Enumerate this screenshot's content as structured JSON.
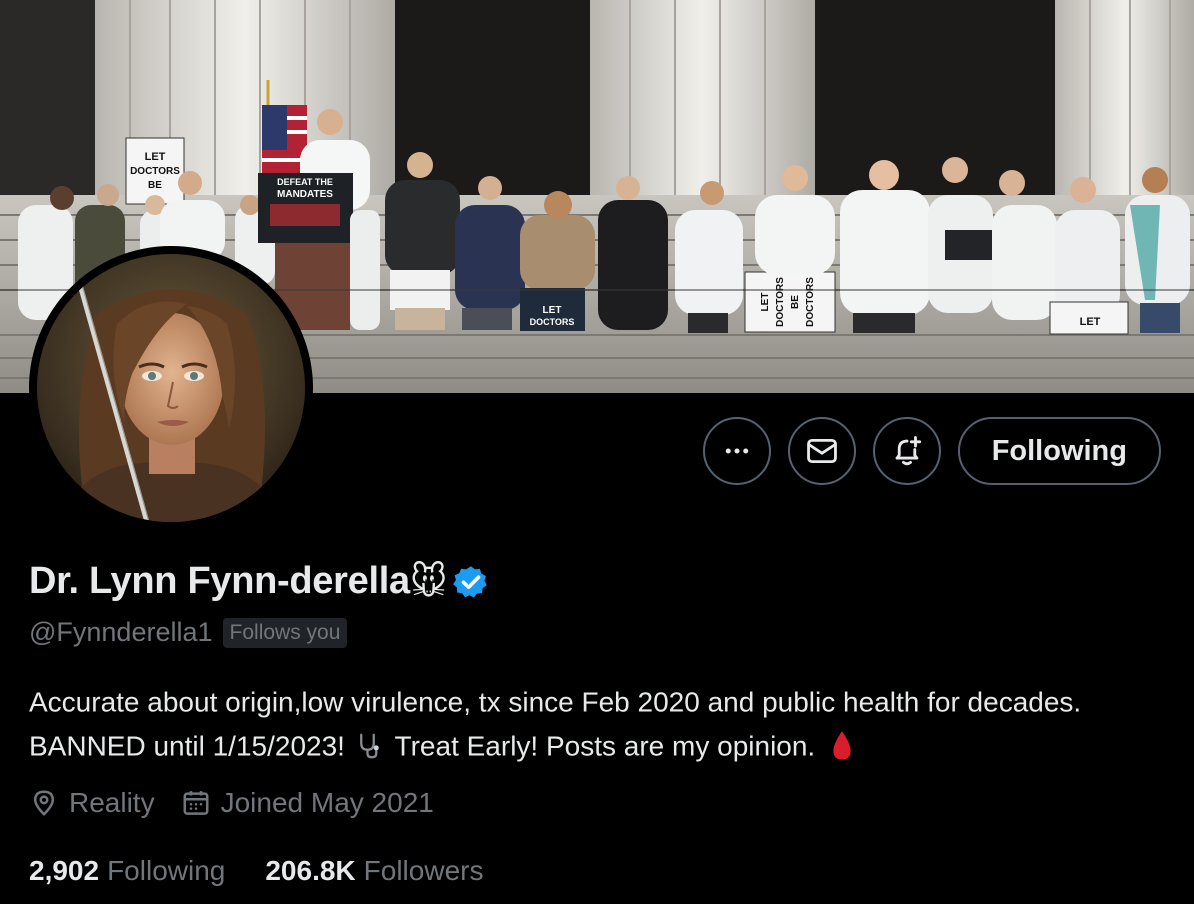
{
  "profile": {
    "display_name": "Dr. Lynn Fynn-derella",
    "name_emoji": "🐭",
    "handle": "@Fynnderella1",
    "follows_you": "Follows you",
    "bio_text_1": "Accurate about origin,low virulence, tx since Feb 2020 and public health for decades. BANNED until 1/15/2023!",
    "bio_text_2": "Treat Early!  Posts are my opinion.",
    "location": "Reality",
    "joined": "Joined May 2021",
    "following_count": "2,902",
    "following_label": "Following",
    "followers_count": "206.8K",
    "followers_label": "Followers"
  },
  "actions": {
    "more_icon": "more-horizontal-icon",
    "message_icon": "envelope-icon",
    "notify_icon": "bell-plus-icon",
    "follow_label": "Following"
  },
  "banner": {
    "podium_line1": "DEFEAT THE",
    "podium_line2": "MANDATES",
    "sign_let": "LET",
    "sign_doctors": "DOCTORS",
    "sign_be": "BE",
    "sign_doctors2": "DOCTORS"
  },
  "colors": {
    "background": "#000000",
    "text_primary": "#e7e9ea",
    "text_secondary": "#71767b",
    "button_border": "#536471",
    "verified_blue": "#1d9bf0",
    "badge_bg": "#202327"
  }
}
